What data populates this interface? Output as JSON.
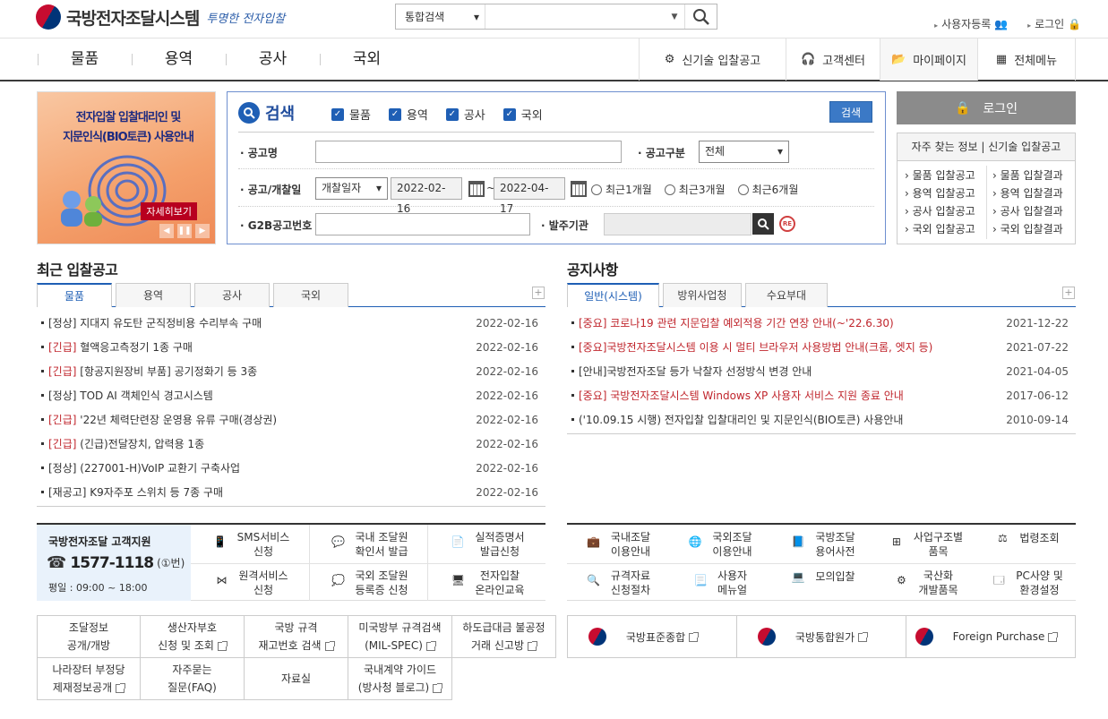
{
  "header": {
    "logo": "국방전자조달시스템",
    "slogan": "투명한 전자입찰",
    "search_type": "통합검색",
    "search_placeholder": "",
    "user_register": "사용자등록",
    "login": "로그인"
  },
  "gnb": {
    "items": [
      "물품",
      "용역",
      "공사",
      "국외"
    ],
    "new_tech": "신기술 입찰공고",
    "customer": "고객센터",
    "mypage": "마이페이지",
    "all_menu": "전체메뉴"
  },
  "banner": {
    "title1": "전자입찰 입찰대리인 및",
    "title2": "지문인식(BIO토큰) 사용안내",
    "more": "자세히보기"
  },
  "search": {
    "title": "검색",
    "types": [
      "물품",
      "용역",
      "공사",
      "국외"
    ],
    "button": "검색",
    "notice_name_label": "공고명",
    "notice_type_label": "공고구분",
    "notice_type_value": "전체",
    "date_label": "공고/개찰일",
    "date_type": "개찰일자",
    "date_from": "2022-02-16",
    "date_sep": "~",
    "date_to": "2022-04-17",
    "radios": [
      "최근1개월",
      "최근3개월",
      "최근6개월"
    ],
    "g2b_label": "G2B공고번호",
    "org_label": "발주기관"
  },
  "login_box": {
    "button": "로그인",
    "quick_title": "자주 찾는 정보 | 신기술 입찰공고",
    "left": [
      "물품 입찰공고",
      "용역 입찰공고",
      "공사 입찰공고",
      "국외 입찰공고"
    ],
    "right": [
      "물품 입찰결과",
      "용역 입찰결과",
      "공사 입찰결과",
      "국외 입찰결과"
    ]
  },
  "recent": {
    "title": "최근 입찰공고",
    "tabs": [
      "물품",
      "용역",
      "공사",
      "국외"
    ],
    "items": [
      {
        "tag": "[정상]",
        "text": " 지대지 유도탄 군직정비용 수리부속 구매",
        "date": "2022-02-16",
        "urgent": false
      },
      {
        "tag": "[긴급]",
        "text": " 혈액응고측정기 1종 구매",
        "date": "2022-02-16",
        "urgent": true
      },
      {
        "tag": "[긴급]",
        "text": " [항공지원장비 부품] 공기정화기 등 3종",
        "date": "2022-02-16",
        "urgent": true
      },
      {
        "tag": "[정상]",
        "text": " TOD AI 객체인식 경고시스템",
        "date": "2022-02-16",
        "urgent": false
      },
      {
        "tag": "[긴급]",
        "text": " '22년 체력단련장 운영용 유류 구매(경상권)",
        "date": "2022-02-16",
        "urgent": true
      },
      {
        "tag": "[긴급]",
        "text": " (긴급)전달장치, 압력용 1종",
        "date": "2022-02-16",
        "urgent": true
      },
      {
        "tag": "[정상]",
        "text": " (227001-H)VoIP 교환기 구축사업",
        "date": "2022-02-16",
        "urgent": false
      },
      {
        "tag": "[재공고]",
        "text": " K9자주포 스위치 등 7종 구매",
        "date": "2022-02-16",
        "urgent": false
      }
    ]
  },
  "notice": {
    "title": "공지사항",
    "tabs": [
      "일반(시스템)",
      "방위사업청",
      "수요부대"
    ],
    "items": [
      {
        "text": "[중요] 코로나19 관련 지문입찰 예외적용 기간 연장 안내(~'22.6.30)",
        "date": "2021-12-22",
        "important": true
      },
      {
        "text": "[중요]국방전자조달시스템 이용 시 멀티 브라우저 사용방법 안내(크롬, 엣지 등)",
        "date": "2021-07-22",
        "important": true
      },
      {
        "text": "[안내]국방전자조달 등가 낙찰자 선정방식 변경 안내",
        "date": "2021-04-05",
        "important": false
      },
      {
        "text": "[중요] 국방전자조달시스템 Windows XP 사용자 서비스 지원 종료 안내",
        "date": "2017-06-12",
        "important": true
      },
      {
        "text": "('10.09.15 시행) 전자입찰 입찰대리인 및 지문인식(BIO토큰) 사용안내",
        "date": "2010-09-14",
        "important": false
      }
    ]
  },
  "cs": {
    "title": "국방전자조달 고객지원",
    "phone": "1577-1118",
    "phone_suffix": "(①번)",
    "hours": "평일 : 09:00 ~ 18:00"
  },
  "services_left": [
    [
      "SMS서비스",
      "신청"
    ],
    [
      "국내 조달원",
      "확인서 발급"
    ],
    [
      "실적증명서",
      "발급신청"
    ],
    [
      "원격서비스",
      "신청"
    ],
    [
      "국외 조달원",
      "등록증 신청"
    ],
    [
      "전자입찰",
      "온라인교육"
    ]
  ],
  "services_right": [
    [
      "국내조달",
      "이용안내"
    ],
    [
      "국외조달",
      "이용안내"
    ],
    [
      "국방조달",
      "용어사전"
    ],
    [
      "사업구조별",
      "품목"
    ],
    [
      "법령조회",
      ""
    ],
    [
      "규격자료",
      "신청절차"
    ],
    [
      "사용자",
      "메뉴얼"
    ],
    [
      "모의입찰",
      ""
    ],
    [
      "국산화",
      "개발품목"
    ],
    [
      "PC사양 및",
      "환경설정"
    ]
  ],
  "bottom_links": [
    [
      "조달정보",
      "공개/개방"
    ],
    [
      "생산자부호",
      "신청 및 조회"
    ],
    [
      "국방 규격",
      "재고번호 검색"
    ],
    [
      "미국방부 규격검색",
      "(MIL-SPEC)"
    ],
    [
      "하도급대금 불공정",
      "거래 신고방"
    ],
    [
      "나라장터 부정당",
      "제재정보공개"
    ],
    [
      "자주묻는",
      "질문(FAQ)"
    ],
    [
      "자료실",
      ""
    ],
    [
      "국내계약 가이드",
      "(방사청 블로그)"
    ]
  ],
  "ext_links": [
    "국방표준종합",
    "국방통합원가",
    "Foreign Purchase"
  ]
}
